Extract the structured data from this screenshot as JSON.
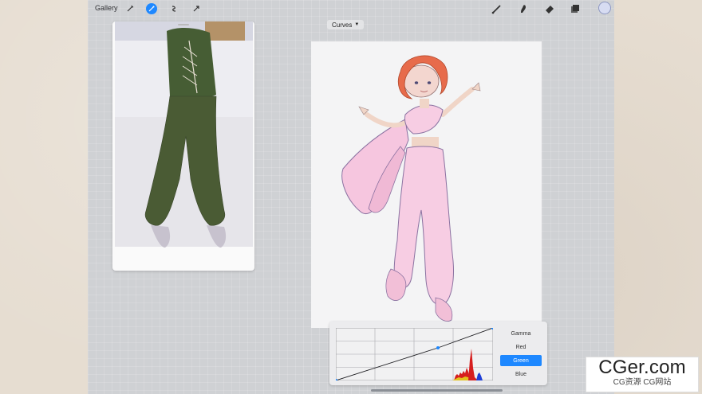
{
  "toolbar": {
    "gallery_label": "Gallery",
    "left_tools": [
      "wrench-icon",
      "magic-wand-icon",
      "selection-icon",
      "transform-icon"
    ],
    "right_tools": [
      "brush-icon",
      "smudge-icon",
      "eraser-icon",
      "layers-icon"
    ],
    "active_tool": "magic-wand-icon",
    "accent_color": "#1e88ff",
    "current_color": "#d7dcf2"
  },
  "adjustment": {
    "mode_label": "Curves",
    "channels": [
      "Gamma",
      "Red",
      "Green",
      "Blue"
    ],
    "active_channel": "Green"
  },
  "watermark": {
    "title": "CGer.com",
    "subtitle": "CG资源 CG网站"
  }
}
